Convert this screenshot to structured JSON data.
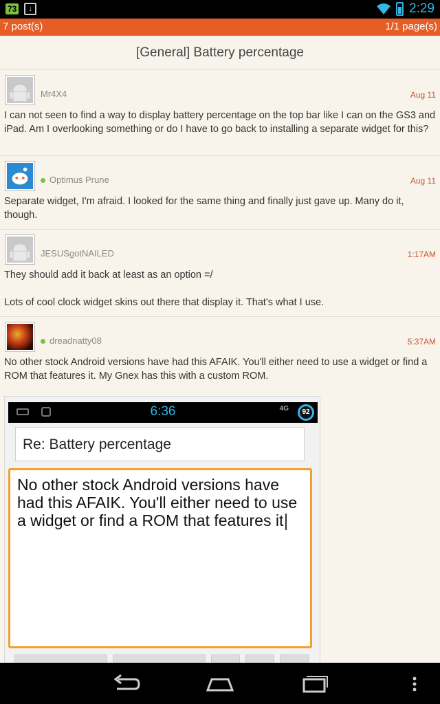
{
  "status_bar": {
    "notif_battery": "73",
    "clock": "2:29",
    "icons": [
      "battery-notification-icon",
      "download-icon",
      "wifi-icon",
      "battery-icon"
    ]
  },
  "thread_bar": {
    "posts": "7 post(s)",
    "pages": "1/1 page(s)"
  },
  "thread": {
    "title": "[General] Battery percentage"
  },
  "posts": [
    {
      "user": "Mr4X4",
      "online": false,
      "time": "Aug 11",
      "body": "I can not seen to find a way to display battery percentage on the top bar like I can on the GS3 and iPad. Am I overlooking something or do I have to go back to installing a separate widget for this?"
    },
    {
      "user": "Optimus Prune",
      "online": true,
      "time": "Aug 11",
      "body": "Separate widget, I'm afraid. I looked for the same thing and finally just gave up. Many do it, though."
    },
    {
      "user": "JESUSgotNAILED",
      "online": false,
      "time": "1:17AM",
      "body": "They should add it back at least as an option =/\n\nLots of cool clock widget skins out there that display it. That's what I use."
    },
    {
      "user": "dreadnatty08",
      "online": true,
      "time": "5:37AM",
      "body": "No other stock Android versions have had this AFAIK. You'll either need to use a widget or find a ROM that features it. My Gnex has this with a custom ROM."
    }
  ],
  "embedded_screenshot": {
    "time": "6:36",
    "network": "4G",
    "battery": "92",
    "subject": "Re: Battery percentage",
    "message": "No other stock Android versions have had this AFAIK. You'll either need to use a widget or find a ROM that features it"
  },
  "colors": {
    "accent_orange": "#e65e25",
    "time_orange": "#c8532a",
    "holo_blue": "#33b5e5",
    "online_green": "#7cc141"
  },
  "nav_bar": {
    "buttons": [
      "back-icon",
      "home-icon",
      "recents-icon",
      "menu-icon"
    ]
  }
}
